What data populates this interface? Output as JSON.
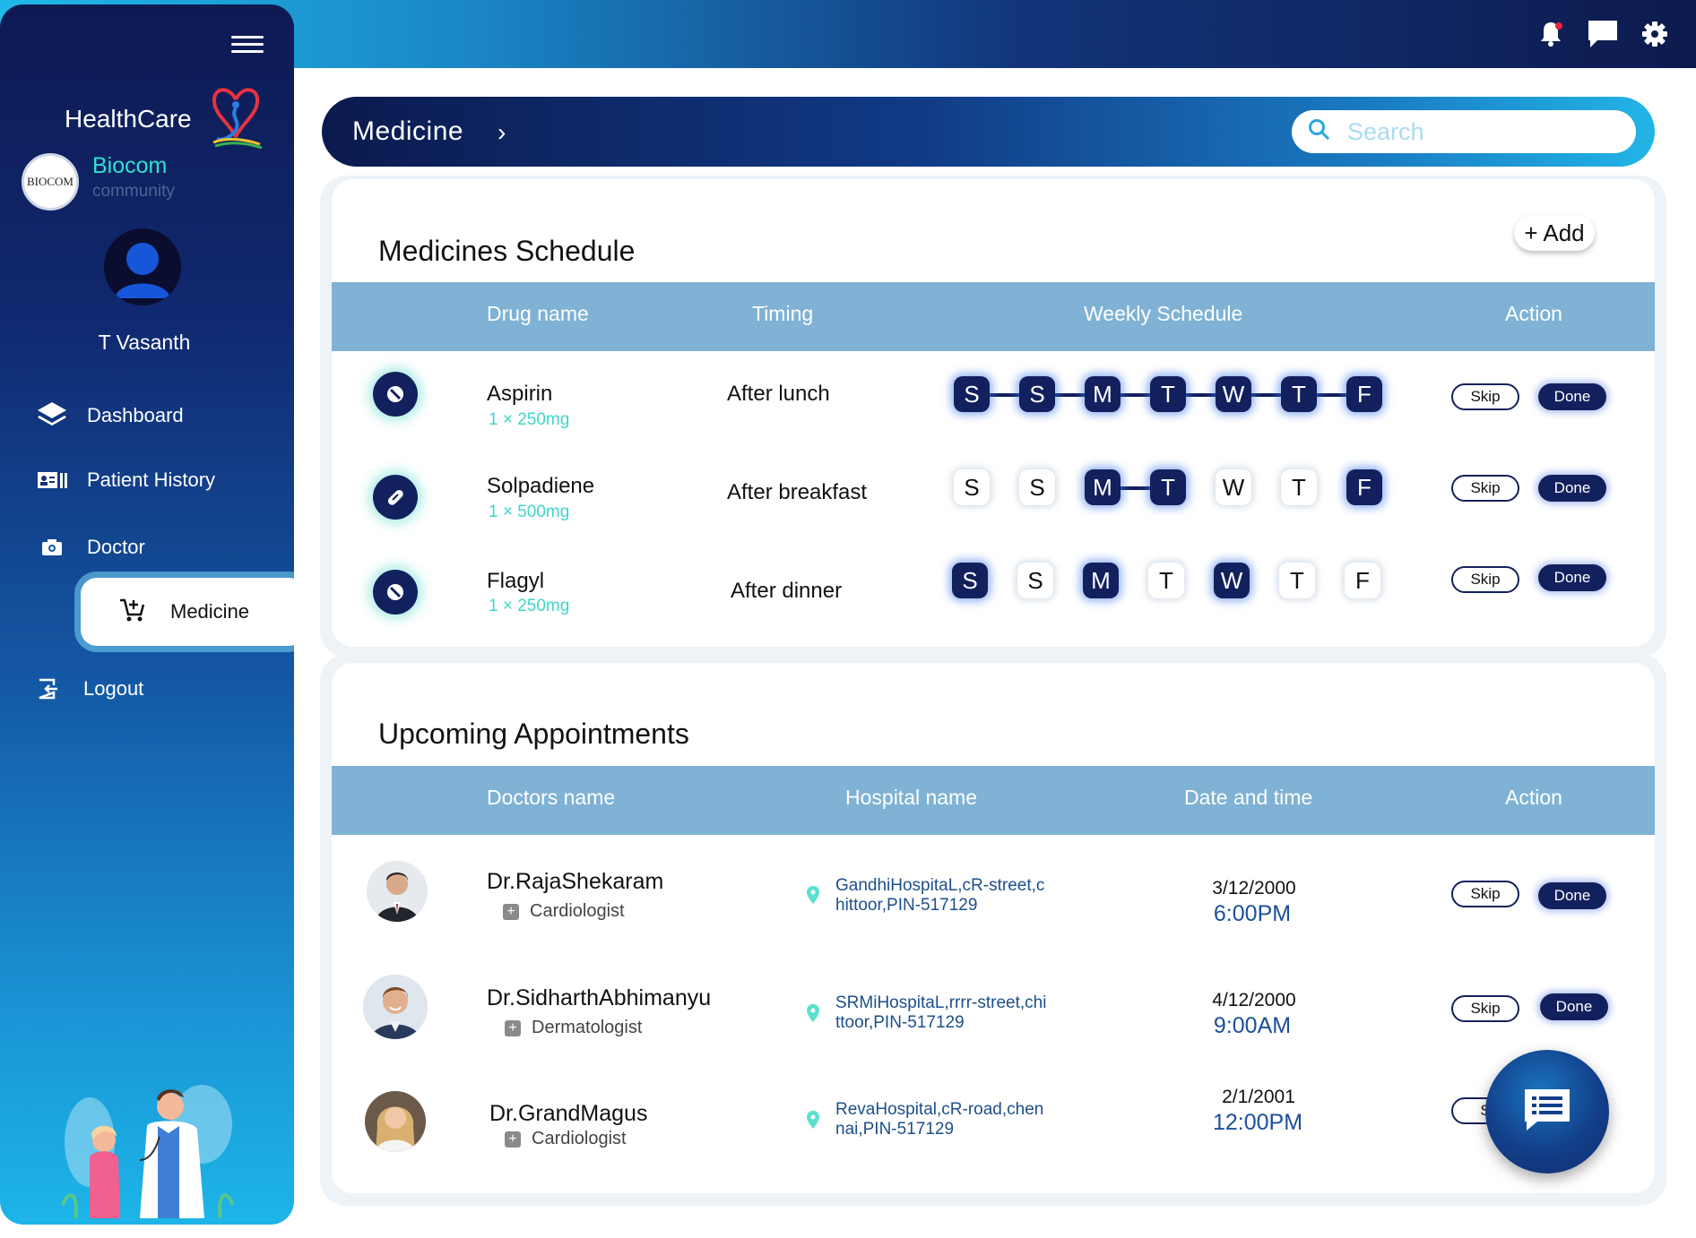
{
  "sidebar": {
    "brand": "HealthCare",
    "org_name": "Biocom",
    "org_sub": "community",
    "org_logo_text": "BIOCOM",
    "user_name": "T Vasanth",
    "nav": [
      {
        "label": "Dashboard",
        "icon": "layers-icon"
      },
      {
        "label": "Patient History",
        "icon": "id-card-icon"
      },
      {
        "label": "Doctor",
        "icon": "camera-icon"
      },
      {
        "label": "Medicine",
        "icon": "cart-add-icon",
        "active": true
      },
      {
        "label": "Logout",
        "icon": "logout-icon"
      }
    ]
  },
  "topbar": {
    "icons": [
      "notification-bell-icon",
      "chat-icon",
      "settings-gear-icon"
    ],
    "notification_dot_color": "#e8233a"
  },
  "breadcrumb": {
    "title": "Medicine",
    "chevron": "›"
  },
  "search": {
    "placeholder": "Search"
  },
  "medicines": {
    "title": "Medicines Schedule",
    "add_label": "+ Add",
    "headers": [
      "Drug name",
      "Timing",
      "Weekly Schedule",
      "Action"
    ],
    "days": [
      "S",
      "S",
      "M",
      "T",
      "W",
      "T",
      "F"
    ],
    "rows": [
      {
        "name": "Aspirin",
        "dose": "1 × 250mg",
        "timing": "After lunch",
        "icon": "pill-forbidden-icon",
        "schedule": [
          true,
          true,
          true,
          true,
          true,
          true,
          true
        ]
      },
      {
        "name": "Solpadiene",
        "dose": "1 × 500mg",
        "timing": "After breakfast",
        "icon": "capsule-icon",
        "schedule": [
          false,
          false,
          true,
          true,
          false,
          false,
          true
        ]
      },
      {
        "name": "Flagyl",
        "dose": "1 × 250mg",
        "timing": "After dinner",
        "icon": "pill-forbidden-icon",
        "schedule": [
          true,
          false,
          true,
          false,
          true,
          false,
          false
        ]
      }
    ],
    "skip_label": "Skip",
    "done_label": "Done"
  },
  "appointments": {
    "title": "Upcoming Appointments",
    "headers": [
      "Doctors name",
      "Hospital name",
      "Date and time",
      "Action"
    ],
    "rows": [
      {
        "doctor": "Dr.RajaShekaram",
        "specialty": "Cardiologist",
        "hospital_l1": "GandhiHospitaL,cR-street,c",
        "hospital_l2": "hittoor,PIN-517129",
        "date": "3/12/2000",
        "time": "6:00PM"
      },
      {
        "doctor": "Dr.SidharthAbhimanyu",
        "specialty": "Dermatologist",
        "hospital_l1": "SRMiHospitaL,rrrr-street,chi",
        "hospital_l2": "ttoor,PIN-517129",
        "date": "4/12/2000",
        "time": "9:00AM"
      },
      {
        "doctor": "Dr.GrandMagus",
        "specialty": "Cardiologist",
        "hospital_l1": "RevaHospital,cR-road,chen",
        "hospital_l2": "nai,PIN-517129",
        "date": "2/1/2001",
        "time": "12:00PM"
      }
    ],
    "skip_label": "Skip",
    "done_label": "Done",
    "partial_skip_label": "S"
  },
  "fab": {
    "icon": "chat-list-icon"
  },
  "colors": {
    "navy": "#13205e",
    "accent_teal": "#3fd6c8",
    "table_header": "#7fb2d4",
    "time_blue": "#1b4f9a"
  }
}
